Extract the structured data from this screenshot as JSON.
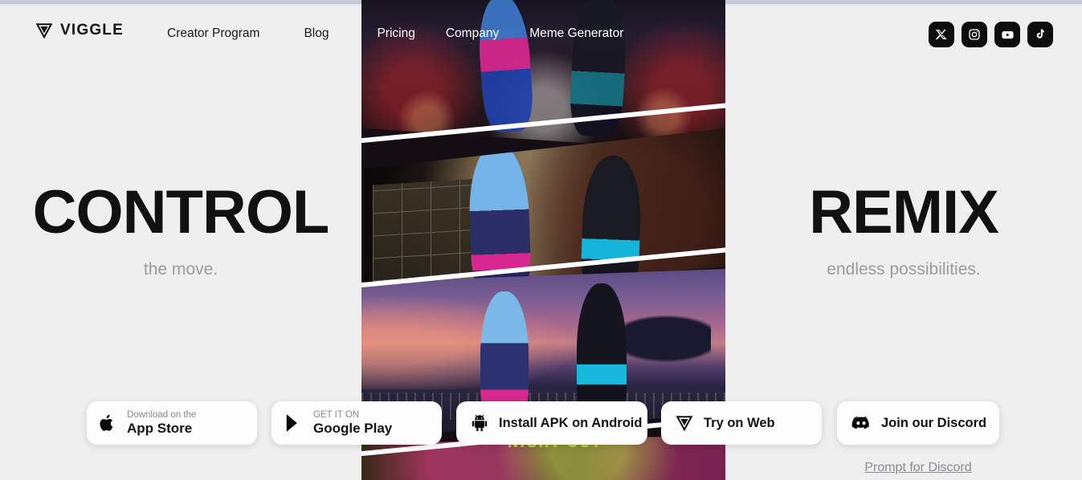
{
  "site": {
    "brand": "VIGGLE",
    "logo_icon": "viggle-v-logo"
  },
  "header": {
    "nav": [
      {
        "label": "Creator Program",
        "on_video": false
      },
      {
        "label": "Blog",
        "on_video": false
      },
      {
        "label": "Pricing",
        "on_video": true
      },
      {
        "label": "Company",
        "on_video": true
      },
      {
        "label": "Meme Generator",
        "on_video": true
      }
    ],
    "socials": [
      {
        "name": "x-twitter-icon",
        "label": "X"
      },
      {
        "name": "instagram-icon",
        "label": "Instagram"
      },
      {
        "name": "youtube-icon",
        "label": "YouTube"
      },
      {
        "name": "tiktok-icon",
        "label": "TikTok"
      }
    ]
  },
  "hero": {
    "left": {
      "title": "CONTROL",
      "subtitle": "the move."
    },
    "right": {
      "title": "REMIX",
      "subtitle": "endless possibilities."
    }
  },
  "video": {
    "panels": [
      {
        "scene": "nightclub-bar-dance",
        "caption": ""
      },
      {
        "scene": "japanese-room-dance",
        "caption": ""
      },
      {
        "scene": "dusk-rooftop-dance",
        "caption": ""
      },
      {
        "scene": "neon-night-out",
        "caption": "NIGHT OUT"
      }
    ]
  },
  "cta": {
    "app_store": {
      "small": "Download on the",
      "big": "App Store",
      "icon": "apple-icon"
    },
    "google_play": {
      "small": "GET IT ON",
      "big": "Google Play",
      "icon": "google-play-icon"
    },
    "apk": {
      "label": "Install APK on Android",
      "icon": "android-icon"
    },
    "web": {
      "label": "Try on Web",
      "icon": "viggle-v-logo"
    },
    "discord": {
      "label": "Join our Discord",
      "icon": "discord-icon"
    },
    "prompt_link": "Prompt for Discord"
  },
  "colors": {
    "background": "#f0eff0",
    "text": "#111111",
    "muted": "#9b9b9f",
    "button_bg": "#fdfdfd",
    "social_bg": "#0d0d0d"
  }
}
